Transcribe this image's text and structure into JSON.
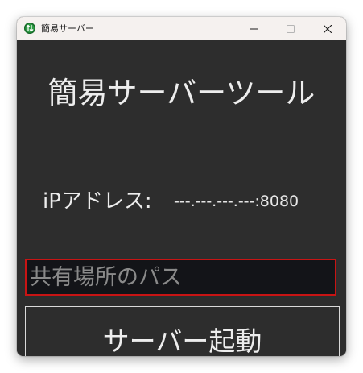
{
  "window": {
    "title": "簡易サーバー",
    "controls": {
      "minimize_icon": "minimize-icon",
      "maximize_icon": "maximize-icon",
      "close_icon": "close-icon"
    }
  },
  "main": {
    "heading": "簡易サーバーツール",
    "ip_label": "iPアドレス:",
    "ip_value": "---.---.---.---:8080",
    "path_input": {
      "value": "",
      "placeholder": "共有場所のパス"
    },
    "start_button_label": "サーバー起動"
  },
  "colors": {
    "client_background": "#2d2d2d",
    "titlebar_background": "#f5f1ef",
    "input_border": "#c81414",
    "input_background": "#131418",
    "app_icon": "#2e9d45"
  }
}
